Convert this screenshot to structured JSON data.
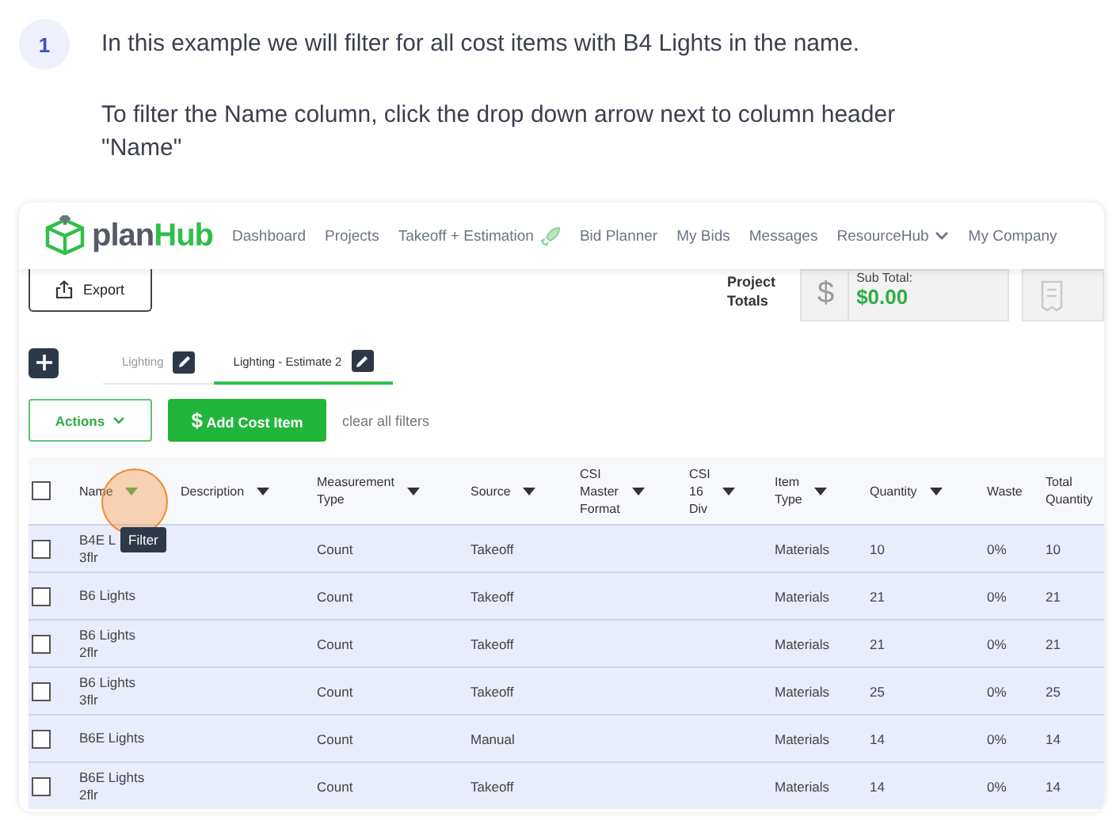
{
  "step": {
    "number": "1",
    "paragraphs": [
      "In this example we will filter for all cost items with B4 Lights in the name.",
      "To filter the Name column, click the drop down arrow next to column header \"Name\""
    ]
  },
  "app": {
    "logo": {
      "prefix": "plan",
      "suffix": "Hub"
    },
    "nav": [
      {
        "label": "Dashboard",
        "kind": "plain"
      },
      {
        "label": "Projects",
        "kind": "plain"
      },
      {
        "label": "Takeoff + Estimation",
        "kind": "rocket"
      },
      {
        "label": "Bid Planner",
        "kind": "plain"
      },
      {
        "label": "My Bids",
        "kind": "plain"
      },
      {
        "label": "Messages",
        "kind": "plain"
      },
      {
        "label": "ResourceHub",
        "kind": "dropdown"
      },
      {
        "label": "My Company",
        "kind": "plain"
      }
    ],
    "export": "Export",
    "totals": {
      "label": "Project Totals",
      "icon": "$",
      "sub_total_label": "Sub Total:",
      "sub_total": "$0.00"
    },
    "tabs": [
      {
        "label": "Lighting",
        "selected": false
      },
      {
        "label": "Lighting - Estimate 2",
        "selected": true
      }
    ],
    "actions": {
      "menu": "Actions",
      "add_icon": "$",
      "add": "Add Cost Item",
      "clear": "clear all filters"
    },
    "select_all_checked": false,
    "columns": [
      {
        "label": "Name",
        "filter": true,
        "highlighted": true,
        "tooltip": "Filter"
      },
      {
        "label": "Description",
        "filter": true
      },
      {
        "label": "Measurement Type",
        "filter": true
      },
      {
        "label": "Source",
        "filter": true
      },
      {
        "label": "CSI Master Format",
        "filter": true
      },
      {
        "label": "CSI 16 Div",
        "filter": true
      },
      {
        "label": "Item Type",
        "filter": true
      },
      {
        "label": "Quantity",
        "filter": true
      },
      {
        "label": "Waste",
        "filter": false
      },
      {
        "label": "Total Quantity",
        "filter": false
      }
    ],
    "rows": [
      {
        "checked": false,
        "name": "B4E L",
        "sub": "3flr",
        "measurement": "Count",
        "source": "Takeoff",
        "item_type": "Materials",
        "quantity": "10",
        "waste": "0%",
        "total": "10"
      },
      {
        "checked": false,
        "name": "B6 Lights",
        "measurement": "Count",
        "source": "Takeoff",
        "item_type": "Materials",
        "quantity": "21",
        "waste": "0%",
        "total": "21"
      },
      {
        "checked": false,
        "name": "B6 Lights",
        "sub": "2flr",
        "measurement": "Count",
        "source": "Takeoff",
        "item_type": "Materials",
        "quantity": "21",
        "waste": "0%",
        "total": "21"
      },
      {
        "checked": false,
        "name": "B6 Lights",
        "sub": "3flr",
        "measurement": "Count",
        "source": "Takeoff",
        "item_type": "Materials",
        "quantity": "25",
        "waste": "0%",
        "total": "25"
      },
      {
        "checked": false,
        "name": "B6E Lights",
        "measurement": "Count",
        "source": "Manual",
        "item_type": "Materials",
        "quantity": "14",
        "waste": "0%",
        "total": "14"
      },
      {
        "checked": false,
        "name": "B6E Lights",
        "sub": "2flr",
        "measurement": "Count",
        "source": "Takeoff",
        "item_type": "Materials",
        "quantity": "14",
        "waste": "0%",
        "total": "14"
      }
    ]
  }
}
